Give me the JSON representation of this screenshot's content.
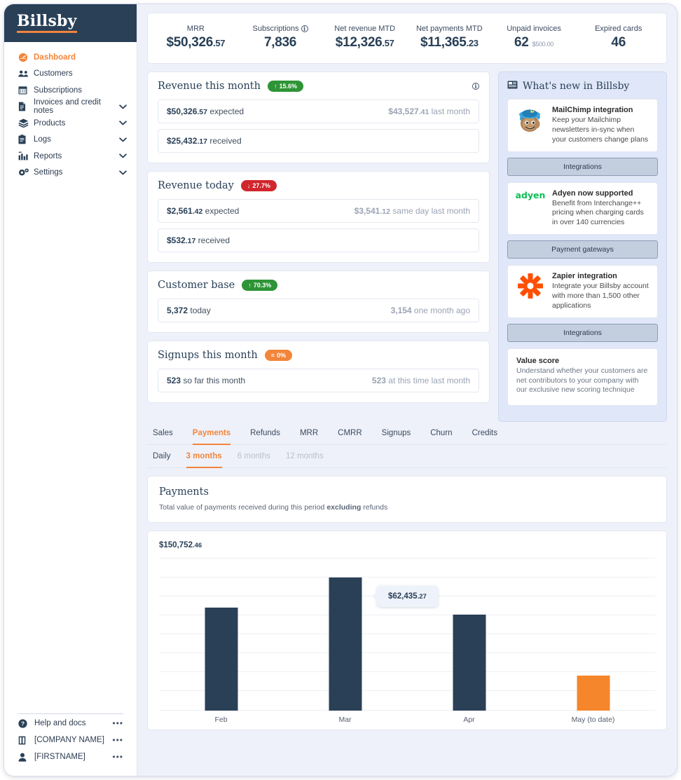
{
  "brand": {
    "name": "Billsby",
    "accent": "#f3853b",
    "navy": "#294057"
  },
  "sidebar": {
    "items": [
      {
        "label": "Dashboard",
        "icon": "gauge-icon",
        "chevron": false,
        "active": true
      },
      {
        "label": "Customers",
        "icon": "people-icon",
        "chevron": false,
        "active": false
      },
      {
        "label": "Subscriptions",
        "icon": "calendar-icon",
        "chevron": false,
        "active": false
      },
      {
        "label": "Invoices and credit notes",
        "icon": "invoice-icon",
        "chevron": true,
        "active": false
      },
      {
        "label": "Products",
        "icon": "products-icon",
        "chevron": true,
        "active": false
      },
      {
        "label": "Logs",
        "icon": "clipboard-icon",
        "chevron": true,
        "active": false
      },
      {
        "label": "Reports",
        "icon": "bar-chart-icon",
        "chevron": true,
        "active": false
      },
      {
        "label": "Settings",
        "icon": "gears-icon",
        "chevron": true,
        "active": false
      }
    ],
    "bottom": [
      {
        "label": "Help and docs",
        "icon": "question-circle-icon",
        "menu": "•••"
      },
      {
        "label": "[COMPANY NAME]",
        "icon": "building-icon",
        "menu": "•••"
      },
      {
        "label": "[FIRSTNAME]",
        "icon": "user-icon",
        "menu": "•••"
      }
    ]
  },
  "stats": [
    {
      "label": "MRR",
      "value": "$50,326",
      "decimal": ".57",
      "info": false,
      "sub": ""
    },
    {
      "label": "Subscriptions",
      "value": "7,836",
      "decimal": "",
      "info": true,
      "sub": ""
    },
    {
      "label": "Net revenue MTD",
      "value": "$12,326",
      "decimal": ".57",
      "info": false,
      "sub": ""
    },
    {
      "label": "Net payments MTD",
      "value": "$11,365",
      "decimal": ".23",
      "info": false,
      "sub": ""
    },
    {
      "label": "Unpaid invoices",
      "value": "62",
      "decimal": "",
      "info": false,
      "sub": "$500.00"
    },
    {
      "label": "Expired cards",
      "value": "46",
      "decimal": "",
      "info": false,
      "sub": ""
    }
  ],
  "metrics": [
    {
      "title": "Revenue this month",
      "pill": {
        "text": "15.6%",
        "arrow": "↑",
        "state": "up"
      },
      "has_info": true,
      "rows": [
        {
          "main": "$50,326",
          "main_dec": ".57",
          "main_suffix": " expected",
          "right": "$43,527",
          "right_dec": ".41",
          "right_suffix": " last month"
        },
        {
          "main": "$25,432",
          "main_dec": ".17",
          "main_suffix": " received",
          "right": "",
          "right_dec": "",
          "right_suffix": ""
        }
      ]
    },
    {
      "title": "Revenue today",
      "pill": {
        "text": "27.7%",
        "arrow": "↓",
        "state": "down"
      },
      "has_info": false,
      "rows": [
        {
          "main": "$2,561",
          "main_dec": ".42",
          "main_suffix": " expected",
          "right": "$3,541",
          "right_dec": ".12",
          "right_suffix": " same day last month"
        },
        {
          "main": "$532",
          "main_dec": ".17",
          "main_suffix": " received",
          "right": "",
          "right_dec": "",
          "right_suffix": ""
        }
      ]
    },
    {
      "title": "Customer base",
      "pill": {
        "text": "70.3%",
        "arrow": "↑",
        "state": "up"
      },
      "has_info": false,
      "rows": [
        {
          "main": "5,372",
          "main_dec": "",
          "main_suffix": " today",
          "right": "3,154",
          "right_dec": "",
          "right_suffix": " one month ago"
        }
      ]
    },
    {
      "title": "Signups this month",
      "pill": {
        "text": "0%",
        "arrow": "≡",
        "state": "flat"
      },
      "has_info": false,
      "rows": [
        {
          "main": "523",
          "main_dec": "",
          "main_suffix": " so far this month",
          "right": "523",
          "right_dec": "",
          "right_suffix": " at this time last month"
        }
      ]
    }
  ],
  "whats_new": {
    "title": "What's new in Billsby",
    "items": [
      {
        "logo": "mailchimp-logo",
        "heading": "MailChimp integration",
        "body": "Keep your Mailchimp newsletters in-sync when your customers change plans",
        "button": "Integrations",
        "faded": false
      },
      {
        "logo": "adyen-logo",
        "heading": "Adyen now supported",
        "body": "Benefit from Interchange++ pricing when charging cards in over 140 currencies",
        "button": "Payment gateways",
        "faded": false
      },
      {
        "logo": "zapier-logo",
        "heading": "Zapier integration",
        "body": "Integrate your Billsby account with more than 1,500 other applications",
        "button": "Integrations",
        "faded": false
      },
      {
        "logo": "",
        "heading": "Value score",
        "body": "Understand whether your customers are net contributors to your company with our exclusive new scoring technique",
        "button": "",
        "faded": true
      }
    ]
  },
  "tabs": {
    "primary": [
      {
        "label": "Sales",
        "active": false,
        "dim": false
      },
      {
        "label": "Payments",
        "active": true,
        "dim": false
      },
      {
        "label": "Refunds",
        "active": false,
        "dim": false
      },
      {
        "label": "MRR",
        "active": false,
        "dim": false
      },
      {
        "label": "CMRR",
        "active": false,
        "dim": false
      },
      {
        "label": "Signups",
        "active": false,
        "dim": false
      },
      {
        "label": "Churn",
        "active": false,
        "dim": false
      },
      {
        "label": "Credits",
        "active": false,
        "dim": false
      }
    ],
    "secondary": [
      {
        "label": "Daily",
        "active": false,
        "dim": false
      },
      {
        "label": "3 months",
        "active": true,
        "dim": false
      },
      {
        "label": "6 months",
        "active": false,
        "dim": true
      },
      {
        "label": "12 months",
        "active": false,
        "dim": true
      }
    ]
  },
  "chart_panel": {
    "title": "Payments",
    "description_before": "Total value of payments received during this period ",
    "description_bold": "excluding",
    "description_after": " refunds",
    "top_value": "$150,752",
    "top_value_dec": ".46"
  },
  "chart_data": {
    "type": "bar",
    "title": "Payments",
    "xlabel": "",
    "ylabel": "",
    "categories": [
      "Feb",
      "Mar",
      "Apr",
      "May (to date)"
    ],
    "values": [
      48500,
      62435.27,
      45000,
      16500
    ],
    "value_labels": [
      "",
      "$62,435.27",
      "",
      ""
    ],
    "ylim": [
      0,
      150752.46
    ],
    "axis_max_label": "$150,752.46",
    "grid": true,
    "gridlines": 8,
    "legend": null,
    "bar_colors": [
      "#294057",
      "#294057",
      "#294057",
      "#f5862b"
    ],
    "highlight_index": 1,
    "tooltip": {
      "index": 1,
      "text": "$62,435",
      "decimal": ".27"
    },
    "x_sublabels": [
      "",
      "",
      "",
      "(to date)"
    ]
  }
}
